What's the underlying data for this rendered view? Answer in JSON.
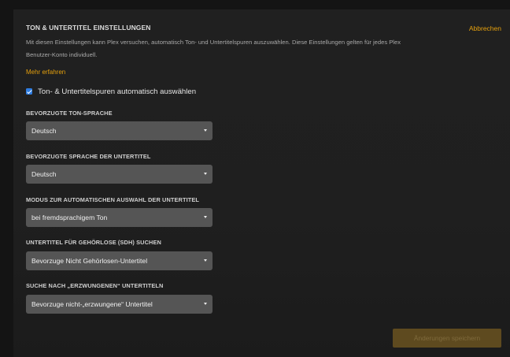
{
  "section": {
    "title": "TON & UNTERTITEL EINSTELLUNGEN",
    "cancel_label": "Abbrechen",
    "description_line1": "Mit diesen Einstellungen kann Plex versuchen, automatisch Ton- und Untertitelspuren auszuwählen. Diese Einstellungen gelten für jedes Plex",
    "description_line2": "Benutzer-Konto individuell.",
    "learn_more": "Mehr erfahren"
  },
  "auto_select": {
    "checked": true,
    "label": "Ton- & Untertitelspuren automatisch auswählen"
  },
  "fields": [
    {
      "label": "BEVORZUGTE TON-SPRACHE",
      "value": "Deutsch"
    },
    {
      "label": "BEVORZUGTE SPRACHE DER UNTERTITEL",
      "value": "Deutsch"
    },
    {
      "label": "MODUS ZUR AUTOMATISCHEN AUSWAHL DER UNTERTITEL",
      "value": "bei fremdsprachigem Ton"
    },
    {
      "label": "UNTERTITEL FÜR GEHÖRLOSE (SDH) SUCHEN",
      "value": "Bevorzuge Nicht Gehörlosen-Untertitel"
    },
    {
      "label": "SUCHE NACH „ERZWUNGENEN“ UNTERTITELN",
      "value": "Bevorzuge nicht-„erzwungene“ Untertitel"
    }
  ],
  "save_button": {
    "label": "Änderungen speichern"
  },
  "colors": {
    "accent": "#e5a00d",
    "checkbox": "#2f7de1",
    "select_bg": "#555555",
    "panel_bg": "#1f1f1f"
  },
  "icons": {
    "dropdown": "chevron-down-icon",
    "checkbox": "checkmark-icon"
  }
}
